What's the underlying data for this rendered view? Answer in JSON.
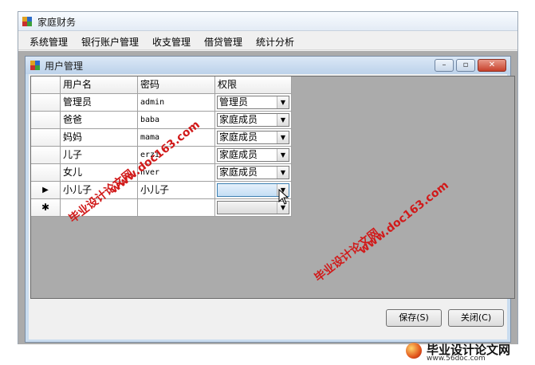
{
  "app": {
    "title": "家庭财务",
    "menu": [
      "系统管理",
      "银行账户管理",
      "收支管理",
      "借贷管理",
      "统计分析"
    ]
  },
  "child_window": {
    "title": "用户管理",
    "controls": {
      "minimize": "–",
      "restore": "▫",
      "close": "✕"
    }
  },
  "grid": {
    "columns": [
      "用户名",
      "密码",
      "权限"
    ],
    "rows": [
      {
        "indicator": "",
        "username": "管理员",
        "password": "admin",
        "role": "管理员"
      },
      {
        "indicator": "",
        "username": "爸爸",
        "password": "baba",
        "role": "家庭成员"
      },
      {
        "indicator": "",
        "username": "妈妈",
        "password": "mama",
        "role": "家庭成员"
      },
      {
        "indicator": "",
        "username": "儿子",
        "password": "erzi",
        "role": "家庭成员"
      },
      {
        "indicator": "",
        "username": "女儿",
        "password": "nver",
        "role": "家庭成员"
      },
      {
        "indicator": "▶",
        "username": "小儿子",
        "password": "小儿子",
        "role": ""
      },
      {
        "indicator": "✱",
        "username": "",
        "password": "",
        "role": ""
      }
    ]
  },
  "buttons": {
    "save": "保存(S)",
    "close": "关闭(C)"
  },
  "watermarks": {
    "site": "www.doc163.com",
    "brand": "毕业设计论文网"
  },
  "footer": {
    "brand": "毕业设计论文网",
    "url": "www.56doc.com"
  },
  "colors": {
    "mdi_background": "#ababab",
    "watermark": "#d11a1a",
    "selection": "#c5def5"
  }
}
